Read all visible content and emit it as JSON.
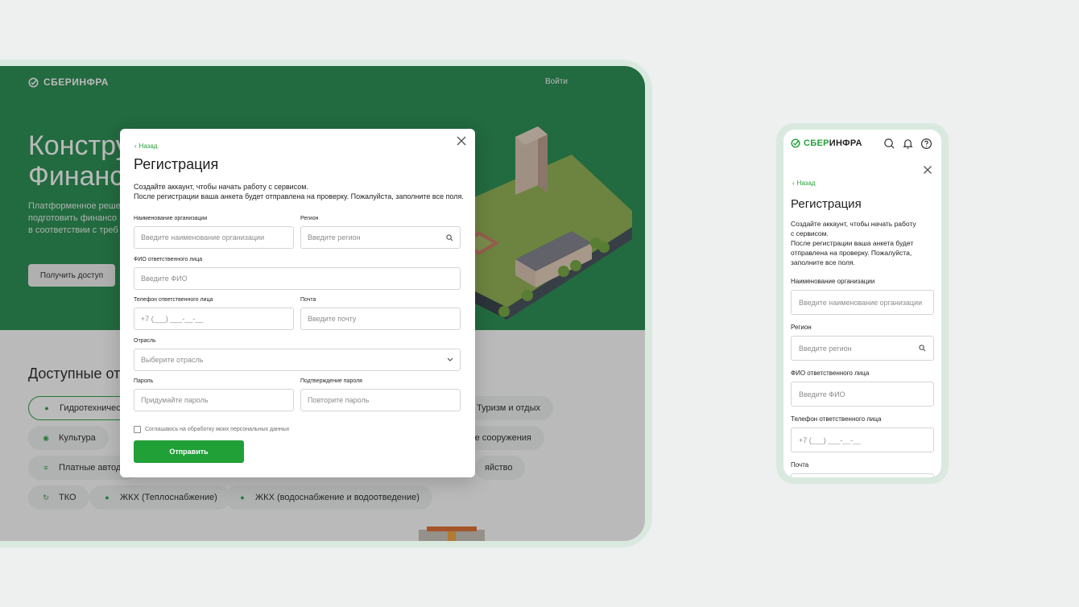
{
  "desktop": {
    "brand": "СБЕРИНФРА",
    "login": "Войти",
    "hero_title_line1": "Констру",
    "hero_title_line2": "Финанс",
    "hero_text_line1": "Платформенное реше",
    "hero_text_line2": "подготовить финансо",
    "hero_text_line3": "в соответствии с треб",
    "hero_button": "Получить доступ",
    "section_title": "Доступные от",
    "chips": [
      {
        "label": "Гидротехническ",
        "icon": "drop-icon",
        "active": true
      },
      {
        "label": "Туризм и отдых",
        "icon": "none"
      },
      {
        "label": "Культура",
        "icon": "mask-icon"
      },
      {
        "label": "еские сооружения",
        "icon": "none"
      },
      {
        "label": "Платные автодо",
        "icon": "road-icon"
      },
      {
        "label": "яйство",
        "icon": "none"
      },
      {
        "label": "ТКО",
        "icon": "recycle-icon"
      },
      {
        "label": "ЖКХ (Теплоснабжение)",
        "icon": "drop-icon"
      },
      {
        "label": "ЖКХ (водоснабжение и водоотведение)",
        "icon": "drop-icon"
      }
    ]
  },
  "modal": {
    "back": "Назад",
    "title": "Регистрация",
    "desc_line1": "Создайте аккаунт, чтобы начать работу с сервисом.",
    "desc_line2": "После регистрации ваша анкета будет отправлена на проверку. Пожалуйста, заполните все поля.",
    "org_label": "Наименование организации",
    "org_placeholder": "Введите наименование организации",
    "region_label": "Регион",
    "region_placeholder": "Введите регион",
    "fio_label": "ФИО ответственного лица",
    "fio_placeholder": "Введите ФИО",
    "phone_label": "Телефон ответственного лица",
    "phone_placeholder": "+7 (___) ___-__-__",
    "email_label": "Почта",
    "email_placeholder": "Введите почту",
    "industry_label": "Отрасль",
    "industry_placeholder": "Выберите отрасль",
    "password_label": "Пароль",
    "password_placeholder": "Придумайте пароль",
    "confirm_label": "Подтверждение пароля",
    "confirm_placeholder": "Повторите пароль",
    "consent": "Соглашаюсь на обработку моих персональных данных",
    "submit": "Отправить"
  },
  "mobile": {
    "brand_green": "СБЕР",
    "brand_dark": "ИНФРА",
    "back": "Назад",
    "title": "Регистрация",
    "desc_line1": "Создайте аккаунт, чтобы начать работу",
    "desc_line2": "с сервисом.",
    "desc_line3": "После регистрации ваша анкета будет",
    "desc_line4": "отправлена на проверку. Пожалуйста,",
    "desc_line5": "заполните все поля.",
    "org_label": "Наименование организации",
    "org_placeholder": "Введите наименование организации",
    "region_label": "Регион",
    "region_placeholder": "Введите регион",
    "fio_label": "ФИО ответственного лица",
    "fio_placeholder": "Введите ФИО",
    "phone_label": "Телефон ответственного лица",
    "phone_placeholder": "+7 (___) ___-__-__",
    "email_label": "Почта"
  },
  "colors": {
    "brand_green": "#21a038",
    "hero_green": "#1f8a4a"
  }
}
